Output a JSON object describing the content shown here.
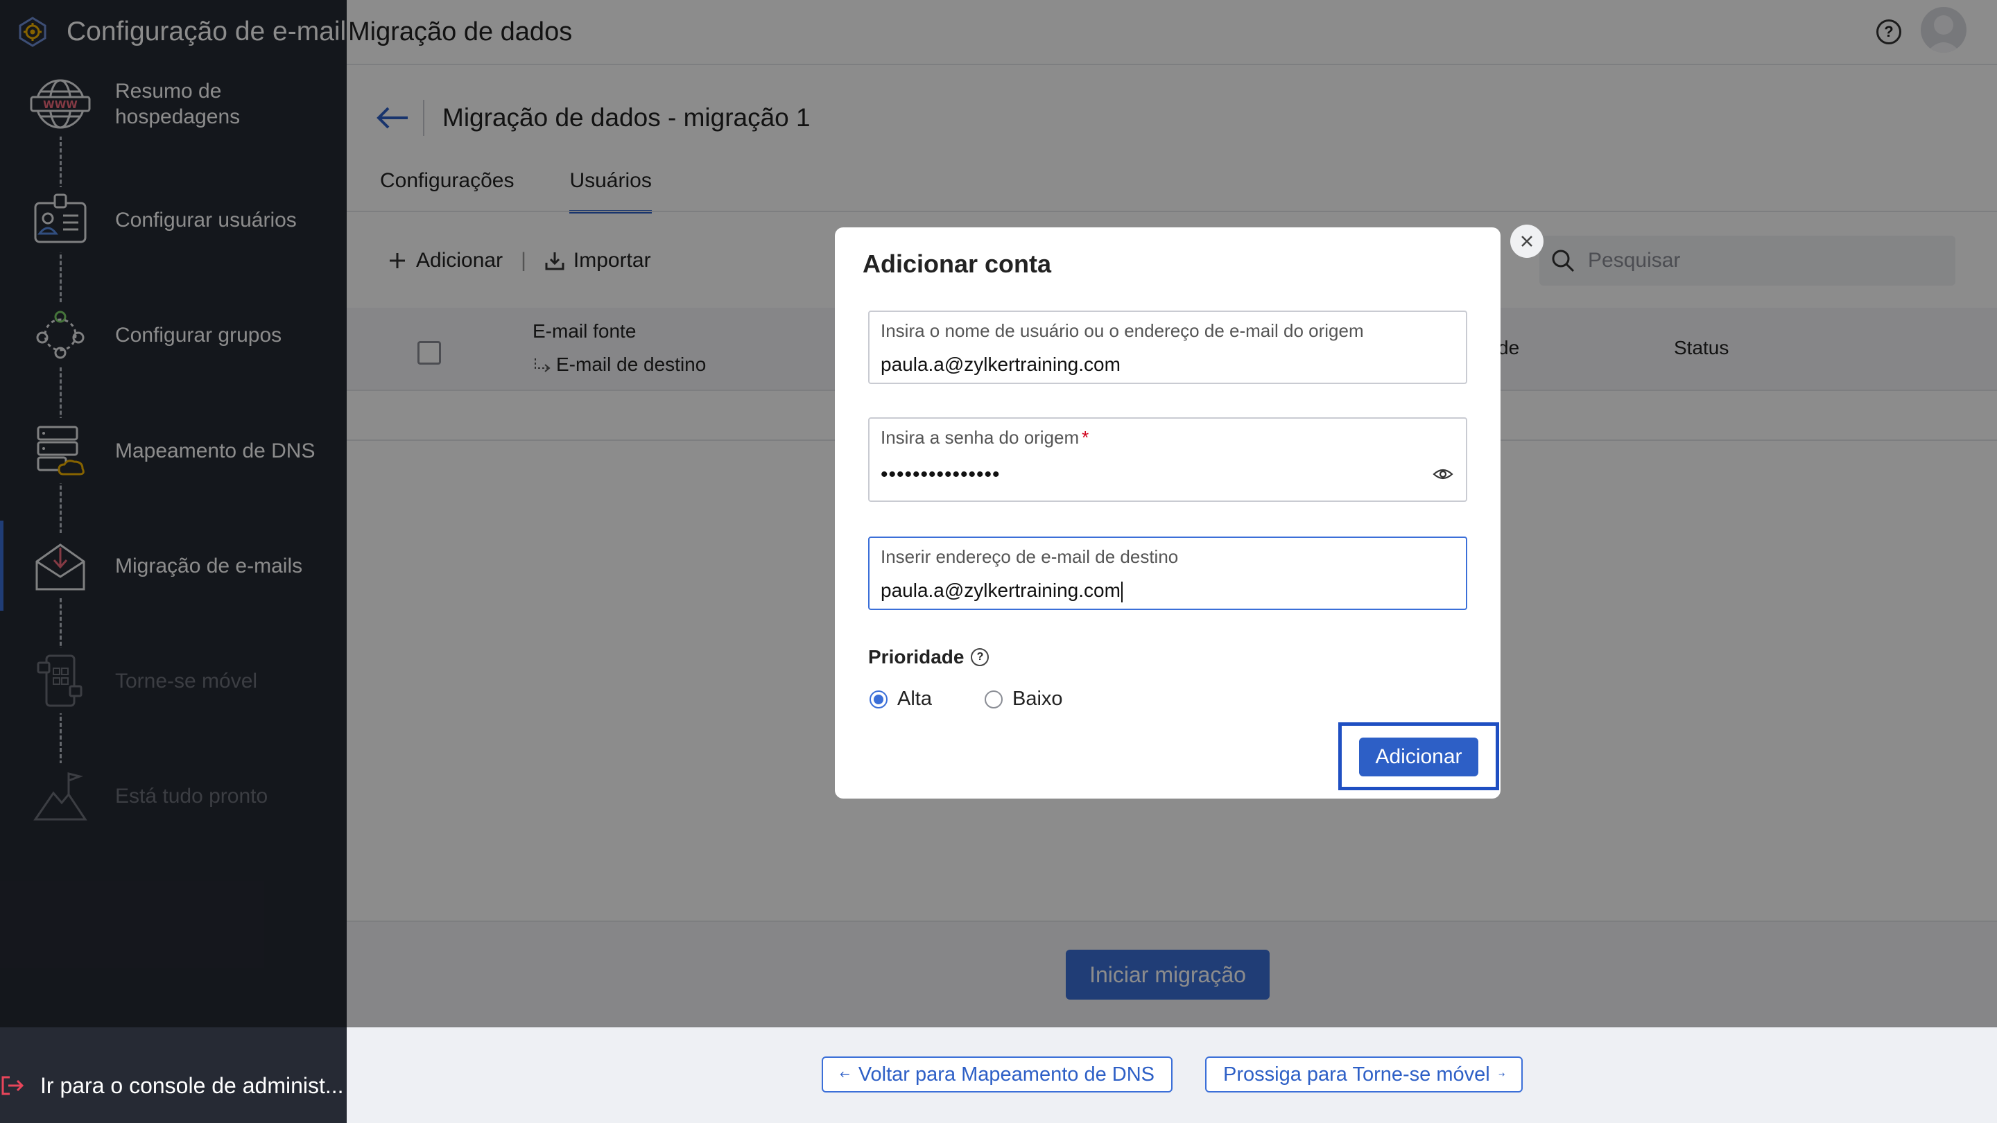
{
  "app": {
    "title": "Configuração de e-mail"
  },
  "sidebar": {
    "steps": [
      {
        "label": "Resumo de hospedagens",
        "icon": "globe-www-icon",
        "state": "done"
      },
      {
        "label": "Configurar usuários",
        "icon": "user-badge-icon",
        "state": "done"
      },
      {
        "label": "Configurar grupos",
        "icon": "group-network-icon",
        "state": "done"
      },
      {
        "label": "Mapeamento de DNS",
        "icon": "server-cloud-icon",
        "state": "done"
      },
      {
        "label": "Migração de e-mails",
        "icon": "mail-download-icon",
        "state": "active"
      },
      {
        "label": "Torne-se móvel",
        "icon": "mobile-apps-icon",
        "state": "disabled"
      },
      {
        "label": "Está tudo pronto",
        "icon": "mountain-flag-icon",
        "state": "disabled"
      }
    ],
    "admin_link": "Ir para o console de administ..."
  },
  "page": {
    "title": "Migração de dados",
    "subtitle": "Migração de dados - migração 1",
    "tabs": [
      {
        "label": "Configurações",
        "active": false
      },
      {
        "label": "Usuários",
        "active": true
      }
    ]
  },
  "toolbar": {
    "add_label": "Adicionar",
    "separator": "|",
    "import_label": "Importar",
    "search_placeholder": "Pesquisar"
  },
  "table": {
    "headers": {
      "source": "E-mail fonte",
      "destination": "E-mail de destino",
      "priority_partial": "de",
      "status": "Status"
    }
  },
  "actions": {
    "start_migration": "Iniciar migração",
    "back": "Voltar para Mapeamento de DNS",
    "next": "Prossiga para Torne-se móvel"
  },
  "modal": {
    "title": "Adicionar conta",
    "fields": {
      "source_user": {
        "label": "Insira o nome de usuário ou o endereço de e-mail do origem",
        "value": "paula.a@zylkertraining.com"
      },
      "source_password": {
        "label": "Insira a senha do origem",
        "required_mark": "*",
        "value": "•••••••••••••••"
      },
      "destination": {
        "label": "Inserir endereço de e-mail de destino",
        "value": "paula.a@zylkertraining.com"
      }
    },
    "priority": {
      "label": "Prioridade",
      "help": "?",
      "options": [
        {
          "label": "Alta",
          "checked": true
        },
        {
          "label": "Baixo",
          "checked": false
        }
      ]
    },
    "submit": "Adicionar"
  },
  "colors": {
    "sidebar_bg": "#262a34",
    "accent": "#3b6fd8",
    "required": "#d0021b",
    "highlight_frame": "#1f4fc2"
  }
}
